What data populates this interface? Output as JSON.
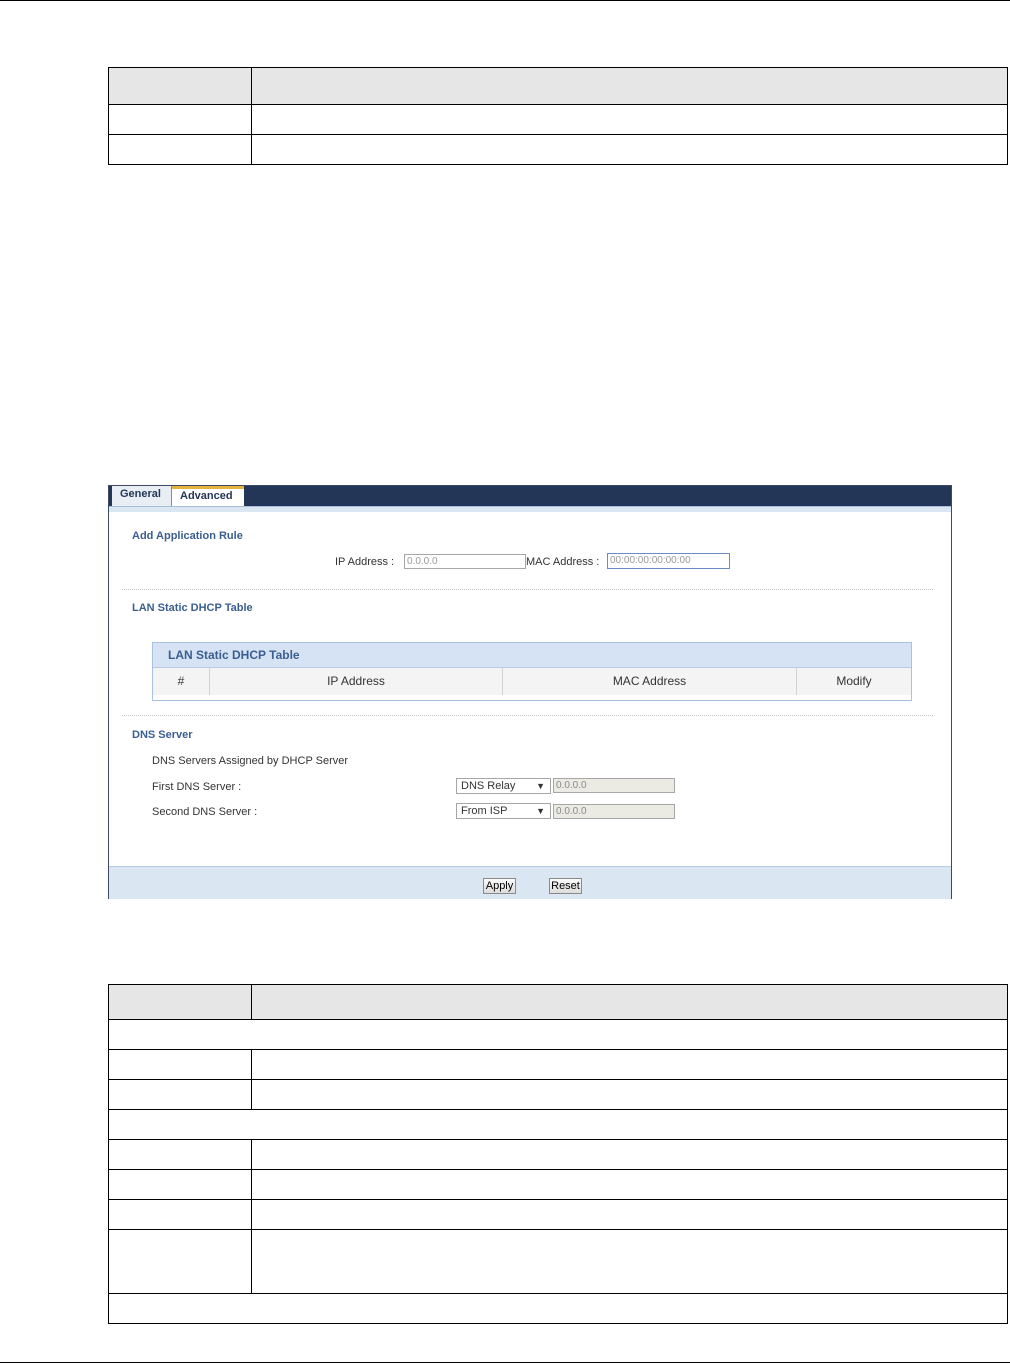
{
  "screenshot": {
    "tabs": [
      {
        "label": "General",
        "active": false
      },
      {
        "label": "Advanced",
        "active": true
      }
    ],
    "add_rule": {
      "title": "Add Application Rule",
      "ip_label": "IP Address :",
      "ip_value": "0.0.0.0",
      "mac_label": "MAC Address :",
      "mac_value": "00:00:00:00:00:00"
    },
    "lan_static": {
      "title": "LAN Static DHCP Table",
      "table_title": "LAN Static DHCP Table",
      "columns": [
        "#",
        "IP Address",
        "MAC Address",
        "Modify"
      ]
    },
    "dns": {
      "title": "DNS Server",
      "subtitle": "DNS Servers Assigned by DHCP Server",
      "first_label": "First DNS Server :",
      "first_select": "DNS Relay",
      "first_value": "0.0.0.0",
      "second_label": "Second DNS Server :",
      "second_select": "From ISP",
      "second_value": "0.0.0.0"
    },
    "buttons": {
      "apply": "Apply",
      "reset": "Reset"
    },
    "colors": {
      "tab_bar": "#243657",
      "section_title": "#3b5e91",
      "panel_bg": "#dbe6f3",
      "active_tab_accent": "#e6b43c"
    }
  }
}
